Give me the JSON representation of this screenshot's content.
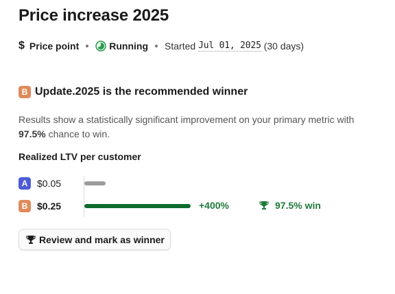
{
  "header": {
    "title": "Price increase 2025",
    "test_type_icon": "dollar-icon",
    "test_type": "Price point",
    "status_icon": "running-icon",
    "status": "Running",
    "started_label": "Started",
    "started_date": "Jul 01, 2025",
    "duration": "(30 days)"
  },
  "winner_banner": {
    "badge": "B",
    "text": "Update.2025 is the recommended winner"
  },
  "summary": {
    "before": "Results show a statistically significant improvement on your primary metric with",
    "chance": "97.5%",
    "after": "chance to win."
  },
  "metric": {
    "title": "Realized LTV per customer",
    "variants": [
      {
        "badge": "A",
        "value": "$0.05",
        "amount": 0.05
      },
      {
        "badge": "B",
        "value": "$0.25",
        "amount": 0.25,
        "lift": "+400%",
        "win_chance": "97.5% win"
      }
    ]
  },
  "actions": {
    "review_button": "Review and mark as winner"
  },
  "colors": {
    "variant_a": "#4d5bd6",
    "variant_b": "#e08a5a",
    "bar_a": "#9c9c9c",
    "bar_b": "#0f6b2f",
    "positive": "#1e7a3a"
  }
}
